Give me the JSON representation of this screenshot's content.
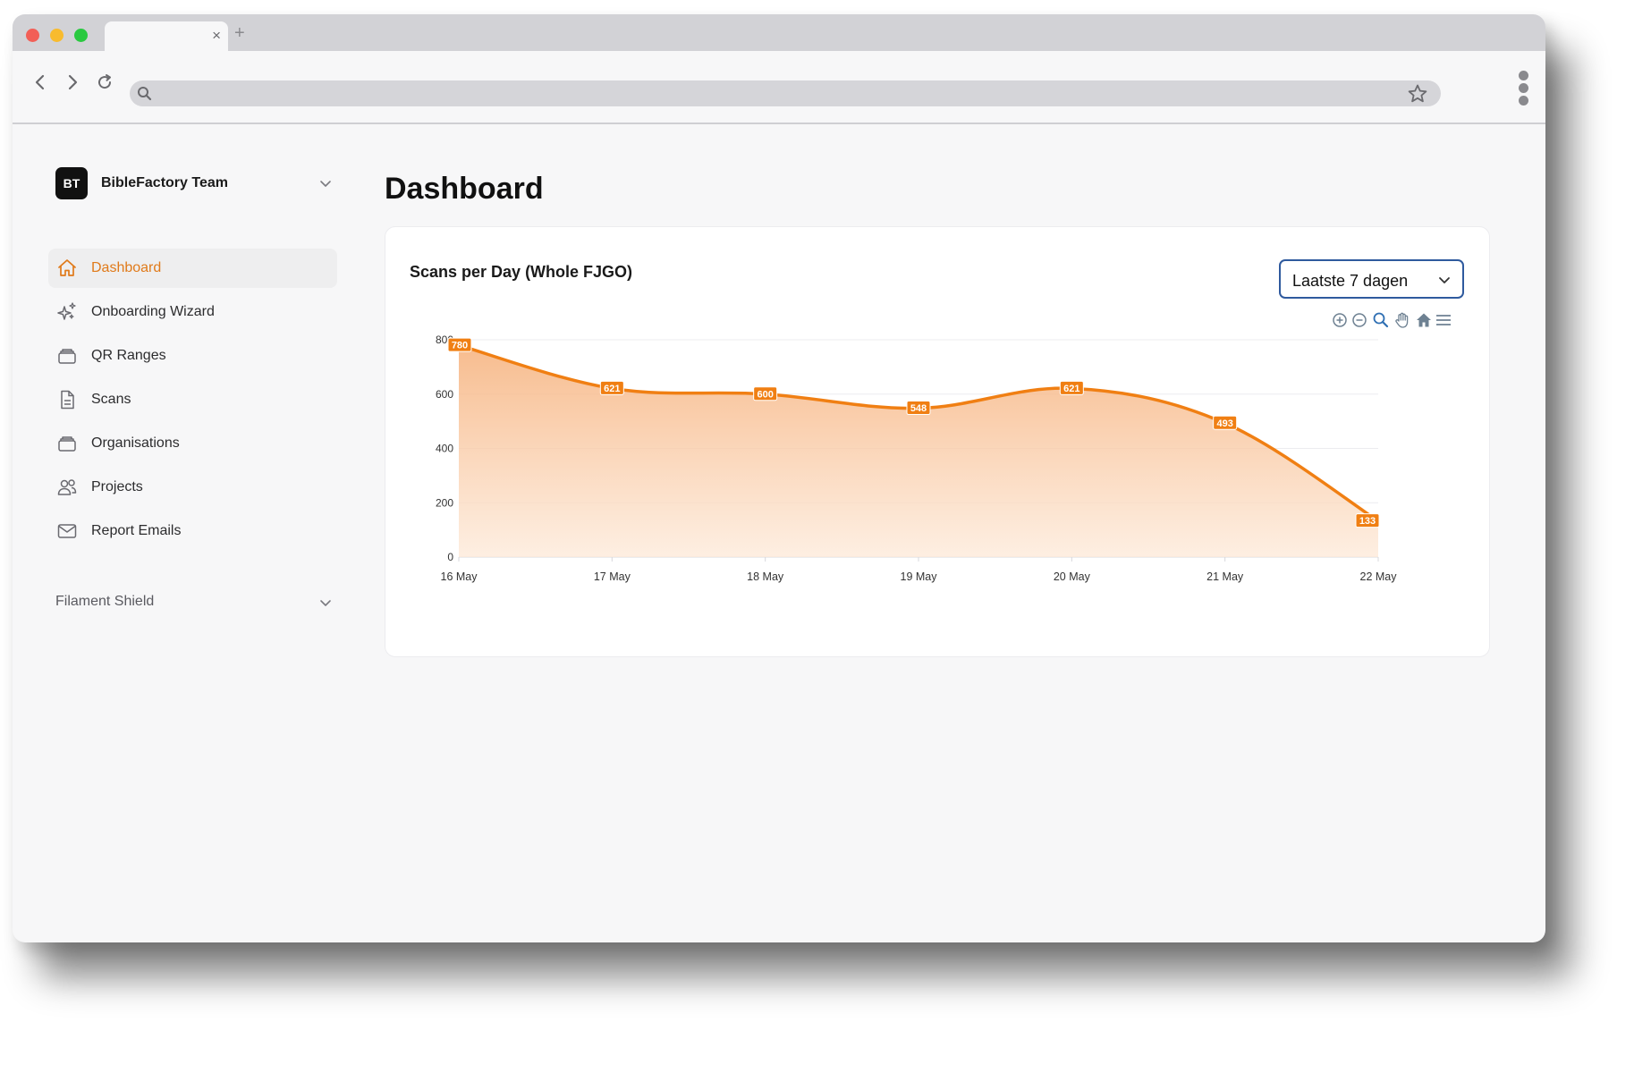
{
  "browser": {
    "tab_close": "×",
    "new_tab": "+",
    "url": ""
  },
  "sidebar": {
    "team": {
      "initials": "BT",
      "name": "BibleFactory Team"
    },
    "items": [
      {
        "label": "Dashboard",
        "icon": "home-icon",
        "active": true
      },
      {
        "label": "Onboarding Wizard",
        "icon": "sparkles-icon",
        "active": false
      },
      {
        "label": "QR Ranges",
        "icon": "stack-icon",
        "active": false
      },
      {
        "label": "Scans",
        "icon": "document-icon",
        "active": false
      },
      {
        "label": "Organisations",
        "icon": "stack-icon",
        "active": false
      },
      {
        "label": "Projects",
        "icon": "users-icon",
        "active": false
      },
      {
        "label": "Report Emails",
        "icon": "envelope-icon",
        "active": false
      }
    ],
    "group": {
      "label": "Filament Shield"
    }
  },
  "main": {
    "title": "Dashboard",
    "card": {
      "title": "Scans per Day (Whole FJGO)",
      "filter": {
        "selected": "Laatste 7 dagen"
      }
    }
  },
  "colors": {
    "accent": "#e07a1a",
    "line": "#f07f13",
    "select_border": "#2f5a9e"
  },
  "chart_data": {
    "type": "area",
    "categories": [
      "16 May",
      "17 May",
      "18 May",
      "19 May",
      "20 May",
      "21 May",
      "22 May"
    ],
    "values": [
      780,
      621,
      600,
      548,
      621,
      493,
      133
    ],
    "ylim": [
      0,
      800
    ],
    "yticks": [
      0,
      200,
      400,
      600,
      800
    ],
    "title": "Scans per Day (Whole FJGO)",
    "xlabel": "",
    "ylabel": "",
    "grid": true,
    "data_labels": true
  }
}
